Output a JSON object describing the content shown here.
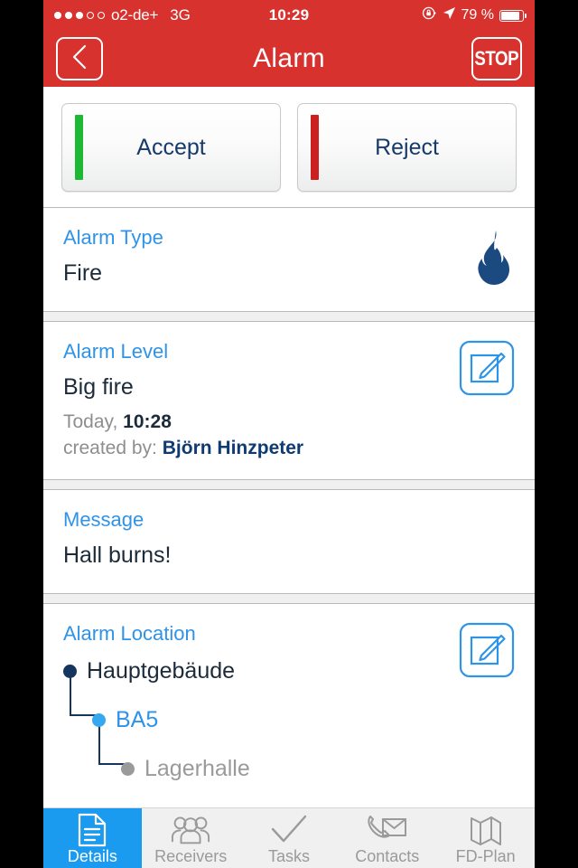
{
  "statusbar": {
    "carrier": "o2-de+",
    "network": "3G",
    "time": "10:29",
    "battery_percent": "79 %",
    "signal_filled": 3,
    "signal_total": 5,
    "rotation_lock_icon": "rotation-lock-icon",
    "location_icon": "location-arrow-icon",
    "battery_icon": "battery-icon"
  },
  "navbar": {
    "title": "Alarm",
    "back_icon": "chevron-left-icon",
    "stop_label": "STOP",
    "background_color": "#d8322e"
  },
  "actions": {
    "accept_label": "Accept",
    "accept_color": "#1db934",
    "reject_label": "Reject",
    "reject_color": "#cc1f1f"
  },
  "sections": {
    "alarm_type": {
      "label": "Alarm Type",
      "value": "Fire",
      "icon": "flame-icon",
      "icon_color": "#1b4a80"
    },
    "alarm_level": {
      "label": "Alarm Level",
      "value": "Big fire",
      "date_prefix": "Today,",
      "time": "10:28",
      "created_prefix": "created by:",
      "created_by": "Björn Hinzpeter",
      "edit_icon": "edit-pencil-icon"
    },
    "message": {
      "label": "Message",
      "value": "Hall burns!"
    },
    "alarm_location": {
      "label": "Alarm Location",
      "edit_icon": "edit-pencil-icon",
      "nodes": [
        {
          "name": "Hauptgebäude",
          "text_color": "#1c2b3a",
          "dot_color": "#16355e"
        },
        {
          "name": "BA5",
          "text_color": "#2f93e8",
          "dot_color": "#36a8f0"
        },
        {
          "name": "Lagerhalle",
          "text_color": "#9a9a9a",
          "dot_color": "#9a9a9a"
        }
      ]
    }
  },
  "tabbar": {
    "active_color": "#1b9bf0",
    "tabs": [
      {
        "label": "Details",
        "icon": "document-icon",
        "active": true
      },
      {
        "label": "Receivers",
        "icon": "people-group-icon",
        "active": false
      },
      {
        "label": "Tasks",
        "icon": "checkmark-icon",
        "active": false
      },
      {
        "label": "Contacts",
        "icon": "phone-envelope-icon",
        "active": false
      },
      {
        "label": "FD-Plan",
        "icon": "map-fold-icon",
        "active": false
      }
    ]
  }
}
